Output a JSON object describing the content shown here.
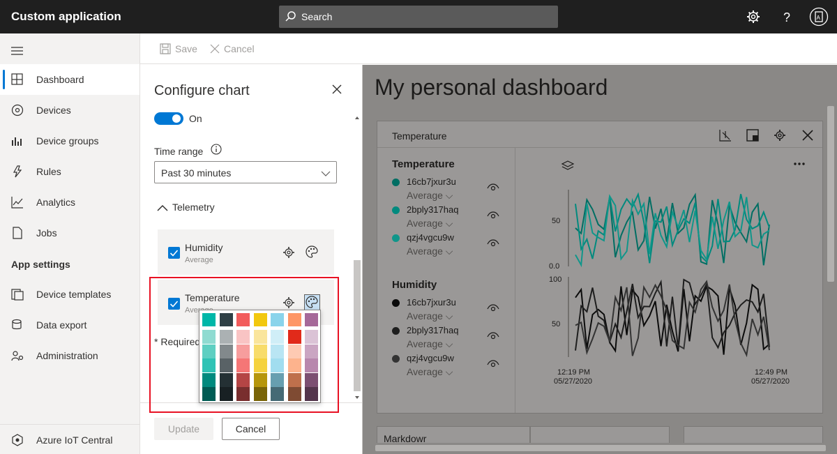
{
  "app": {
    "title": "Custom application"
  },
  "search": {
    "placeholder": "Search"
  },
  "topbar_icons": [
    "gear-icon",
    "help-icon",
    "account-icon"
  ],
  "sidebar": {
    "items": [
      {
        "label": "Dashboard",
        "icon": "dashboard-icon",
        "active": true
      },
      {
        "label": "Devices",
        "icon": "devices-icon"
      },
      {
        "label": "Device groups",
        "icon": "device-groups-icon"
      },
      {
        "label": "Rules",
        "icon": "rules-icon"
      },
      {
        "label": "Analytics",
        "icon": "analytics-icon"
      },
      {
        "label": "Jobs",
        "icon": "jobs-icon"
      }
    ],
    "section_app_settings": "App settings",
    "settings_items": [
      {
        "label": "Device templates",
        "icon": "device-templates-icon"
      },
      {
        "label": "Data export",
        "icon": "data-export-icon"
      },
      {
        "label": "Administration",
        "icon": "administration-icon"
      }
    ],
    "footer_item": {
      "label": "Azure IoT Central",
      "icon": "iot-central-icon"
    }
  },
  "toolbar": {
    "save_label": "Save",
    "cancel_label": "Cancel"
  },
  "panel": {
    "title": "Configure chart",
    "toggle_label": "On",
    "time_range_label": "Time range",
    "time_range_value": "Past 30 minutes",
    "telemetry_label": "Telemetry",
    "cards": [
      {
        "name": "Humidity",
        "aggregation": "Average",
        "checked": true
      },
      {
        "name": "Temperature",
        "aggregation": "Average",
        "checked": true
      }
    ],
    "required_note": "* Required",
    "update_label": "Update",
    "cancel_label": "Cancel"
  },
  "palette": {
    "top_row": [
      "#00b7a8",
      "#2f4046",
      "#f25c5c",
      "#f2c80f",
      "#8ad4eb",
      "#fe9666",
      "#a66999"
    ],
    "columns": [
      [
        "#8fdbd1",
        "#5ecfc2",
        "#2fc3b5",
        "#008a7e",
        "#005c54"
      ],
      [
        "#abb1b3",
        "#82898c",
        "#596266",
        "#243034",
        "#182023"
      ],
      [
        "#f9c4c4",
        "#f79d9d",
        "#f57676",
        "#b54545",
        "#792e2e"
      ],
      [
        "#fae59c",
        "#f8dc6b",
        "#f5d23e",
        "#b6960b",
        "#796407"
      ],
      [
        "#d0eef7",
        "#b9e5f3",
        "#a1ddef",
        "#679fb0",
        "#456a75"
      ],
      [
        "#e12a1a",
        "#fecab3",
        "#fdb38d",
        "#bf704c",
        "#7f4b33"
      ],
      [
        "#dbc3d6",
        "#caa5c2",
        "#b887ad",
        "#7c4f72",
        "#53354c"
      ]
    ]
  },
  "dashboard": {
    "title": "My personal dashboard",
    "tile_title": "Temperature",
    "groups": [
      {
        "name": "Temperature",
        "devices": [
          {
            "id": "16cb7jxur3u",
            "agg": "Average",
            "color": "#006e63"
          },
          {
            "id": "2bply317haq",
            "agg": "Average",
            "color": "#008a7e"
          },
          {
            "id": "qzj4vgcu9w",
            "agg": "Average",
            "color": "#10968a"
          }
        ]
      },
      {
        "name": "Humidity",
        "devices": [
          {
            "id": "16cb7jxur3u",
            "agg": "Average",
            "color": "#0b0b0b"
          },
          {
            "id": "2bply317haq",
            "agg": "Average",
            "color": "#1e1e1e"
          },
          {
            "id": "qzj4vgcu9w",
            "agg": "Average",
            "color": "#333333"
          }
        ]
      }
    ],
    "axis": {
      "temp_ticks": [
        "50",
        "0.0"
      ],
      "hum_ticks": [
        "100",
        "50"
      ],
      "x_start_time": "12:19 PM",
      "x_start_date": "05/27/2020",
      "x_end_time": "12:49 PM",
      "x_end_date": "05/27/2020"
    },
    "minitile_label": "Markdowr"
  }
}
